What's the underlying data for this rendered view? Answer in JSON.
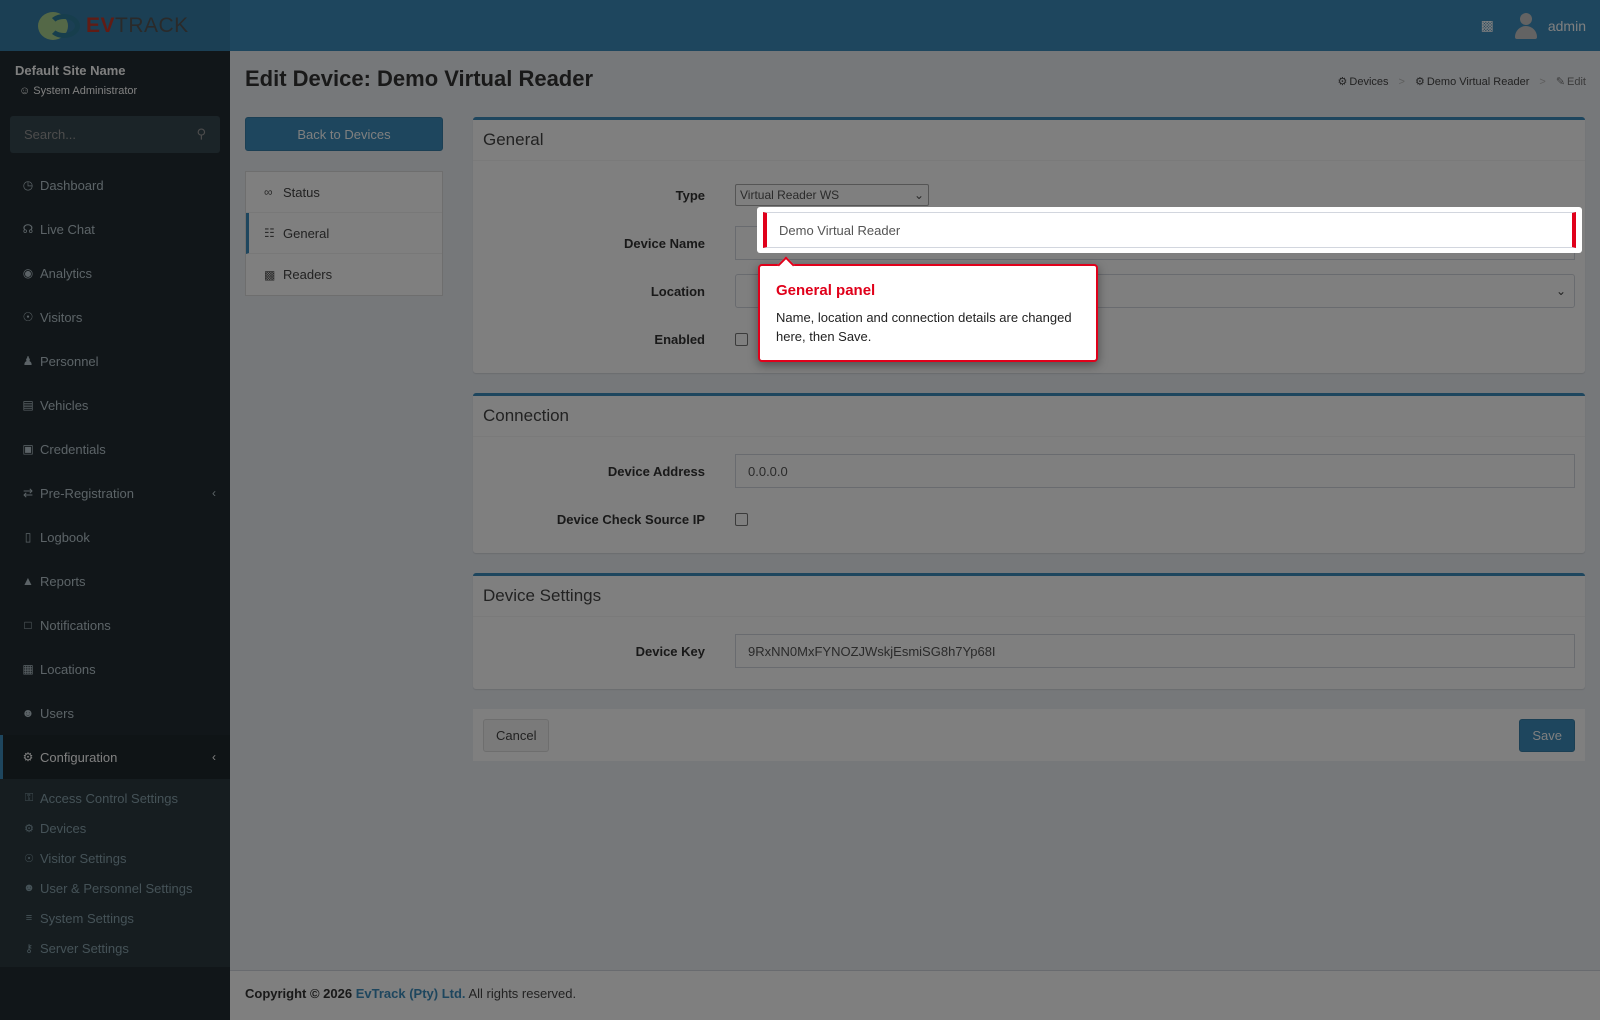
{
  "header": {
    "logo_prefix": "EV",
    "logo_suffix": "TRACK",
    "user_name": "admin"
  },
  "sidebar": {
    "site_name": "Default Site Name",
    "role": "System Administrator",
    "search_placeholder": "Search...",
    "items": [
      {
        "label": "Dashboard",
        "icon": "dashboard-icon"
      },
      {
        "label": "Live Chat",
        "icon": "headset-icon"
      },
      {
        "label": "Analytics",
        "icon": "target-icon"
      },
      {
        "label": "Visitors",
        "icon": "eye-icon"
      },
      {
        "label": "Personnel",
        "icon": "person-icon"
      },
      {
        "label": "Vehicles",
        "icon": "car-icon"
      },
      {
        "label": "Credentials",
        "icon": "id-card-icon"
      },
      {
        "label": "Pre-Registration",
        "icon": "arrows-icon"
      },
      {
        "label": "Logbook",
        "icon": "book-icon"
      },
      {
        "label": "Reports",
        "icon": "chart-icon"
      },
      {
        "label": "Notifications",
        "icon": "chat-icon"
      },
      {
        "label": "Locations",
        "icon": "map-icon"
      },
      {
        "label": "Users",
        "icon": "users-icon"
      },
      {
        "label": "Configuration",
        "icon": "gear-icon"
      }
    ],
    "submenu": [
      {
        "label": "Access Control Settings",
        "icon": "lock-icon"
      },
      {
        "label": "Devices",
        "icon": "gear-icon"
      },
      {
        "label": "Visitor Settings",
        "icon": "eye-icon"
      },
      {
        "label": "User & Personnel Settings",
        "icon": "users-icon"
      },
      {
        "label": "System Settings",
        "icon": "sliders-icon"
      },
      {
        "label": "Server Settings",
        "icon": "key-icon"
      }
    ]
  },
  "page": {
    "title": "Edit Device: Demo Virtual Reader",
    "breadcrumb": [
      "Devices",
      "Demo Virtual Reader",
      "Edit"
    ],
    "back_button": "Back to Devices",
    "nav": [
      "Status",
      "General",
      "Readers"
    ]
  },
  "general": {
    "title": "General",
    "type_label": "Type",
    "type_value": "Virtual Reader WS",
    "device_name_label": "Device Name",
    "device_name_value": "Demo Virtual Reader",
    "location_label": "Location",
    "enabled_label": "Enabled"
  },
  "connection": {
    "title": "Connection",
    "address_label": "Device Address",
    "address_value": "0.0.0.0",
    "check_ip_label": "Device Check Source IP"
  },
  "device_settings": {
    "title": "Device Settings",
    "key_label": "Device Key",
    "key_value": "9RxNN0MxFYNOZJWskjEsmiSG8h7Yp68I"
  },
  "actions": {
    "cancel": "Cancel",
    "save": "Save"
  },
  "footer": {
    "copyright": "Copyright © 2026",
    "company": "EvTrack (Pty) Ltd.",
    "rights": "All rights reserved."
  },
  "tooltip": {
    "title": "General panel",
    "body": "Name, location and connection details are changed here, then Save."
  }
}
